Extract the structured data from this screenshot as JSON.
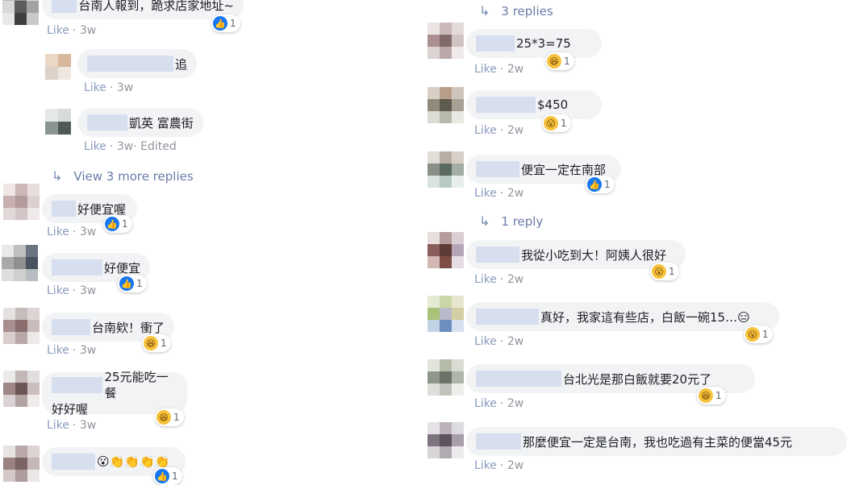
{
  "left": {
    "comments": [
      {
        "text": "台南人報到，跪求店家地址~",
        "meta_like": "Like",
        "meta_time": "3w",
        "react_count": "1"
      },
      {
        "text": "追",
        "meta_like": "Like",
        "meta_time": "3w"
      },
      {
        "text": "凱英 富農街",
        "meta_like": "Like",
        "meta_time": "3w",
        "meta_edited": "Edited"
      },
      {
        "text": "好便宜喔",
        "meta_like": "Like",
        "meta_time": "3w",
        "react_count": "1"
      },
      {
        "text": "好便宜",
        "meta_like": "Like",
        "meta_time": "3w",
        "react_count": "1"
      },
      {
        "text": "台南欸！衝了",
        "meta_like": "Like",
        "meta_time": "3w",
        "react_count": "1"
      },
      {
        "text_line1": "25元能吃一餐",
        "text_line2": "好好喔",
        "meta_like": "Like",
        "meta_time": "3w",
        "react_count": "1"
      },
      {
        "text": "😮👏👏👏👏",
        "react_count": "1"
      }
    ],
    "more_replies": "View 3 more replies"
  },
  "right": {
    "top_replies": "3 replies",
    "comments": [
      {
        "text": "25*3=75",
        "meta_like": "Like",
        "meta_time": "2w",
        "react_count": "1"
      },
      {
        "text": "$450",
        "meta_like": "Like",
        "meta_time": "2w",
        "react_count": "1"
      },
      {
        "text": "便宜一定在南部",
        "meta_like": "Like",
        "meta_time": "2w",
        "react_count": "1"
      },
      {
        "text": "我從小吃到大！阿姨人很好",
        "meta_like": "Like",
        "meta_time": "2w",
        "react_count": "1"
      },
      {
        "text": "真好，我家這有些店，白飯一碗15…😑",
        "meta_like": "Like",
        "meta_time": "2w",
        "react_count": "1"
      },
      {
        "text": "台北光是那白飯就要20元了",
        "meta_like": "Like",
        "meta_time": "2w",
        "react_count": "1"
      },
      {
        "text": "那麼便宜一定是台南，我也吃過有主菜的便當45元",
        "meta_like": "Like",
        "meta_time": "2w"
      }
    ],
    "one_reply": "1 reply"
  },
  "icons": {
    "like": "like-reaction-icon",
    "haha": "haha-reaction-icon",
    "wow": "wow-reaction-icon",
    "reply_arrow": "reply-arrow-icon"
  },
  "colors": {
    "bubble": "#f2f3f5",
    "link": "#90949c",
    "like_blue": "#1877f2"
  }
}
